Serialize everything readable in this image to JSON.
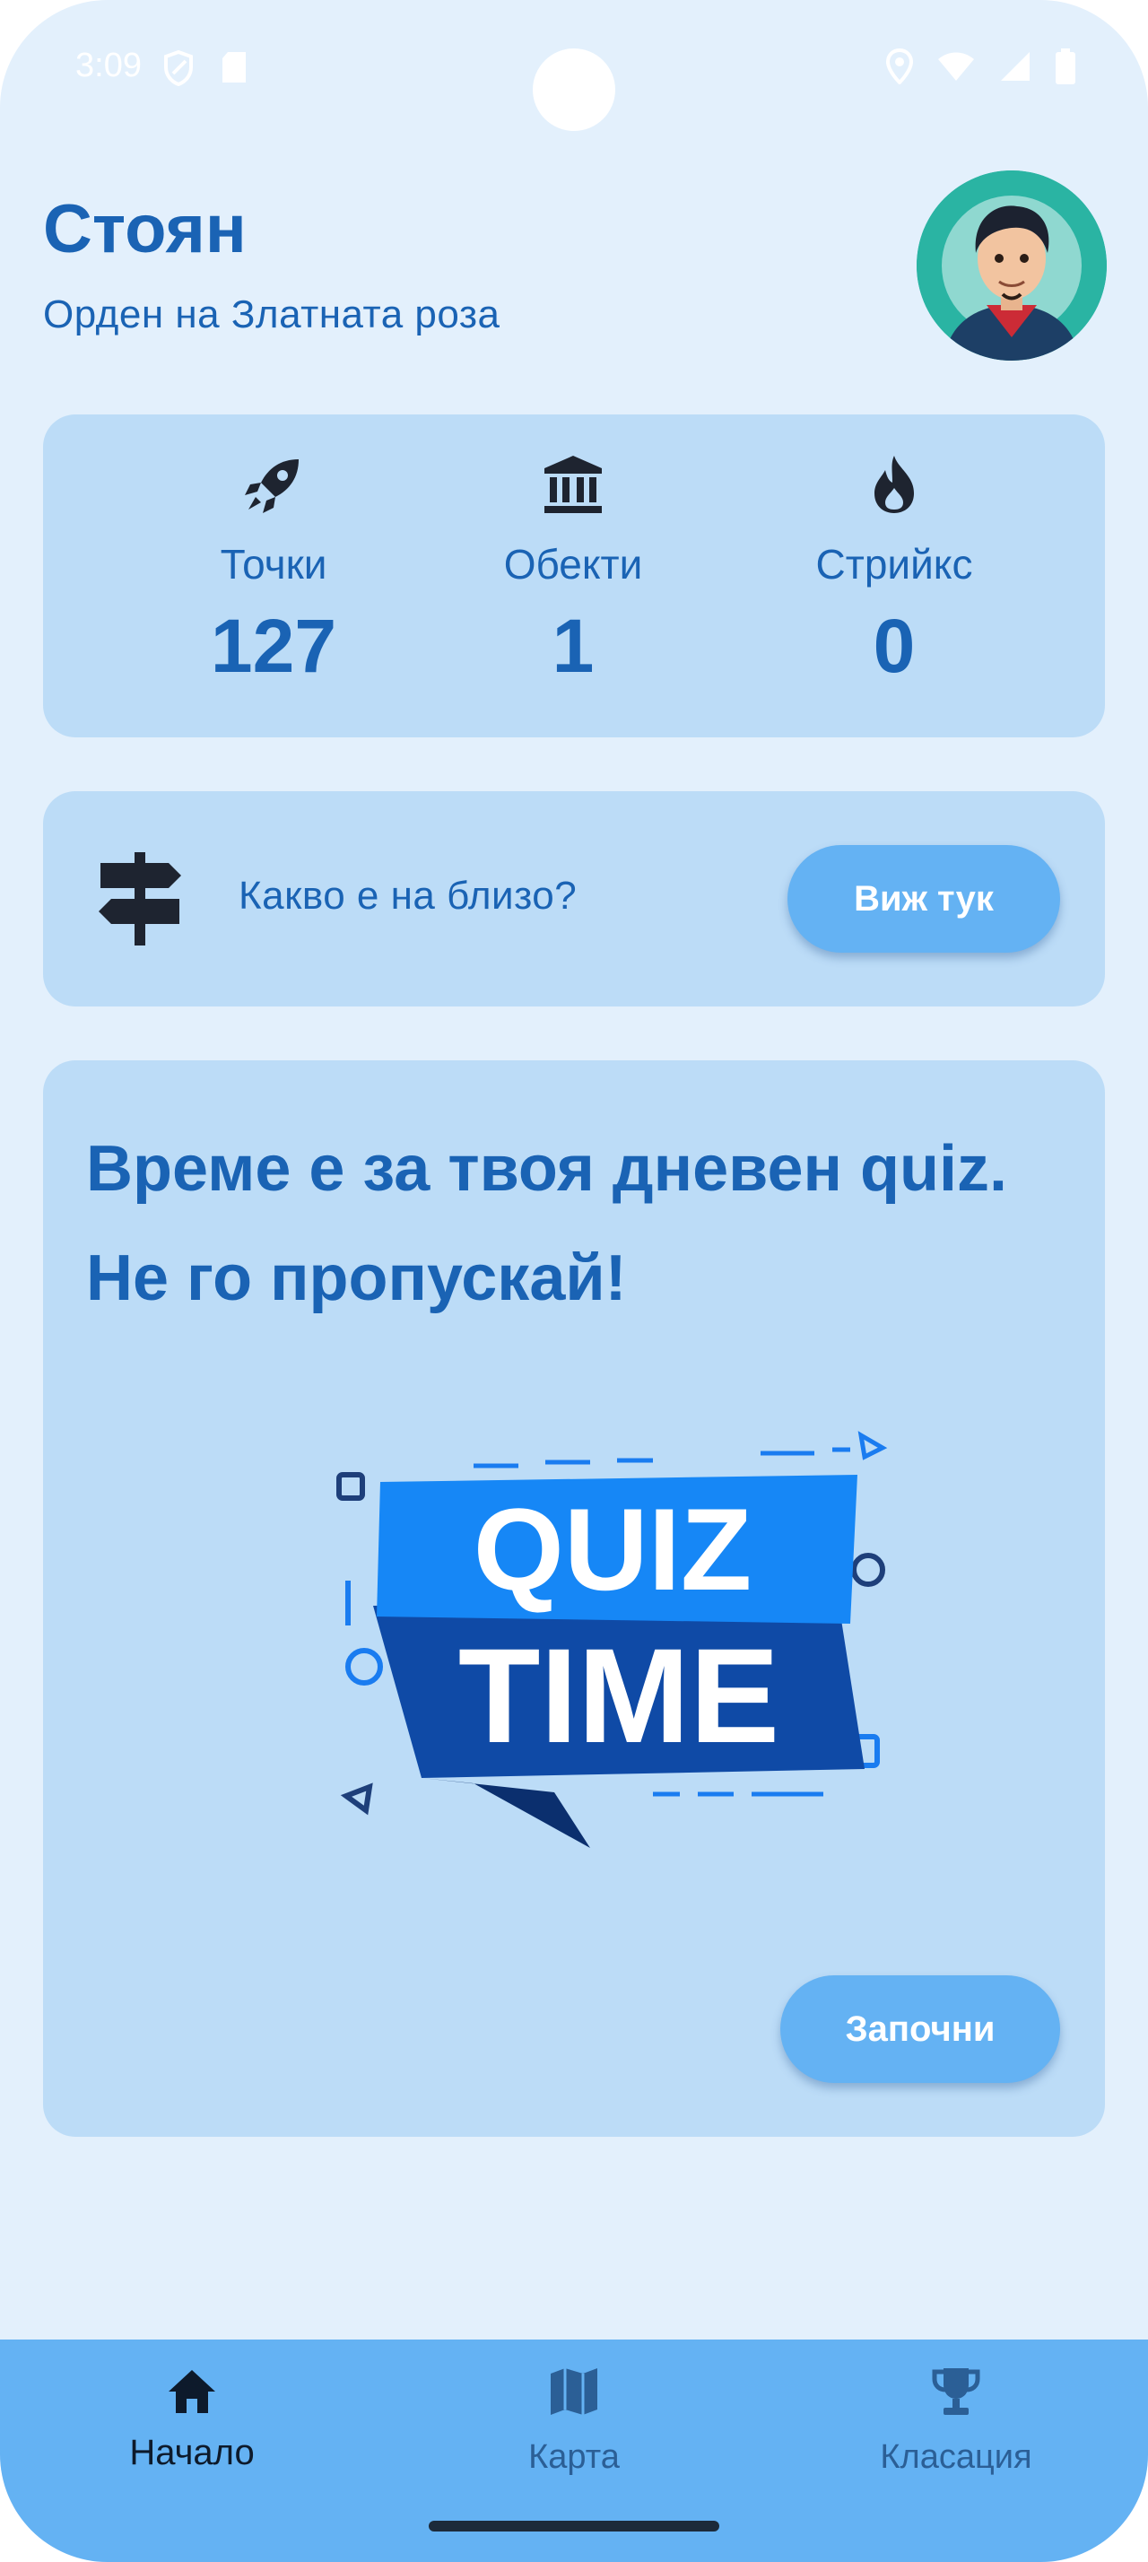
{
  "status_bar": {
    "time": "3:09",
    "left_icons": [
      "shield-icon",
      "sd-card-icon"
    ],
    "right_icons": [
      "location-icon",
      "wifi-icon",
      "signal-icon",
      "battery-icon"
    ]
  },
  "header": {
    "name": "Стоян",
    "title": "Орден на Златната роза",
    "avatar": "avatar-icon"
  },
  "stats": [
    {
      "icon": "rocket-icon",
      "label": "Точки",
      "value": "127"
    },
    {
      "icon": "museum-icon",
      "label": "Обекти",
      "value": "1"
    },
    {
      "icon": "fire-icon",
      "label": "Стрийкс",
      "value": "0"
    }
  ],
  "nearby": {
    "icon": "signpost-icon",
    "text": "Какво е на близо?",
    "button_label": "Виж тук"
  },
  "quiz": {
    "heading": "Време е за твоя дневен quiz. Не го пропускай!",
    "image_text_line1": "QUIZ",
    "image_text_line2": "TIME",
    "button_label": "Започни"
  },
  "bottom_nav": {
    "items": [
      {
        "icon": "home-icon",
        "label": "Начало",
        "active": true
      },
      {
        "icon": "map-icon",
        "label": "Карта",
        "active": false
      },
      {
        "icon": "trophy-icon",
        "label": "Класация",
        "active": false
      }
    ]
  },
  "colors": {
    "background": "#e3f0fc",
    "card": "#bcdcf7",
    "accent_text": "#1a63b4",
    "button": "#64b2f3",
    "nav_bar": "#64b2f3"
  }
}
